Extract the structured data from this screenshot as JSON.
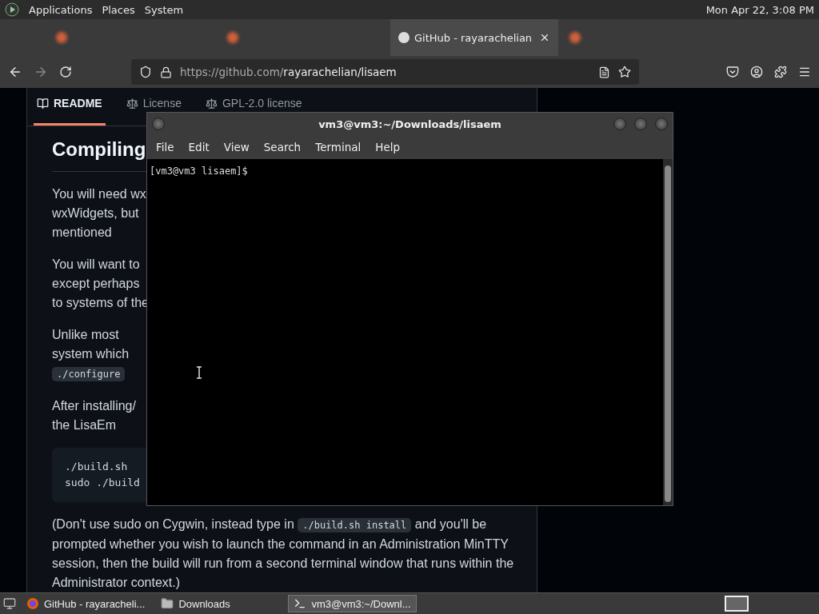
{
  "top_panel": {
    "menus": [
      "Applications",
      "Places",
      "System"
    ],
    "clock": "Mon Apr 22,  3:08 PM"
  },
  "browser": {
    "tabs": [
      {
        "selected": false
      },
      {
        "selected": false
      },
      {
        "label": "GitHub - rayarachelian",
        "selected": true
      },
      {
        "selected": false
      }
    ],
    "url": {
      "host": "https://github.com/",
      "path": "rayarachelian/lisaem"
    },
    "readme_tabs": [
      {
        "label": "README",
        "selected": true
      },
      {
        "label": "License",
        "selected": false
      },
      {
        "label": "GPL-2.0 license",
        "selected": false
      }
    ],
    "heading": "Compiling",
    "paragraphs": [
      [
        "You will need wx",
        "wxWidgets, but",
        "mentioned"
      ],
      [
        "You will want to",
        "except perhaps",
        "to systems of the"
      ],
      [
        "Unlike most",
        "system which"
      ]
    ],
    "inline_code": "./configure",
    "paragraph_after": [
      "After installing/",
      "the LisaEm"
    ],
    "code_lines": [
      "./build.sh",
      "sudo ./build"
    ],
    "note": "(Don't use sudo on Cygwin, instead type in ",
    "note_code": "./build.sh install",
    "note_rest": " and you'll be prompted whether you wish to launch the command in an Administration MinTTY session, then the build will run from a second terminal window that runs within the Administrator context.)"
  },
  "terminal": {
    "title": "vm3@vm3:~/Downloads/lisaem",
    "menus": [
      "File",
      "Edit",
      "View",
      "Search",
      "Terminal",
      "Help"
    ],
    "prompt": "[vm3@vm3 lisaem]$"
  },
  "taskbar": [
    {
      "label": "GitHub - rayaracheli...",
      "kind": "browser",
      "selected": false
    },
    {
      "label": "Downloads",
      "kind": "folder",
      "selected": false
    },
    {
      "label": "vm3@vm3:~/Downl...",
      "kind": "terminal",
      "selected": true
    }
  ]
}
